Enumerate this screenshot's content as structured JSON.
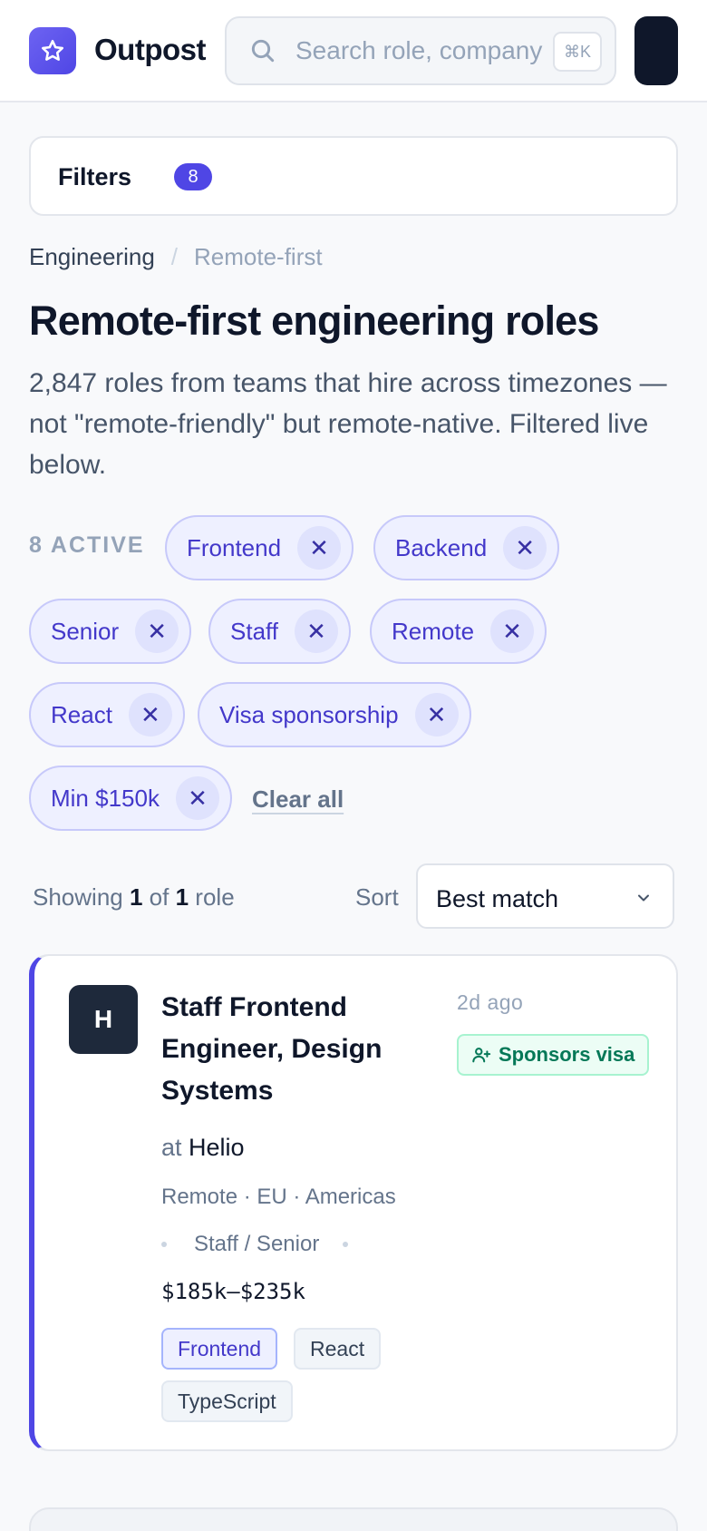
{
  "header": {
    "brand": "Outpost",
    "search_placeholder": "Search role, company",
    "shortcut": "⌘K"
  },
  "filters": {
    "label": "Filters",
    "count": "8"
  },
  "breadcrumb": {
    "parent": "Engineering",
    "separator": "/",
    "current": "Remote-first"
  },
  "page": {
    "title": "Remote-first engineering roles",
    "description": "2,847 roles from teams that hire across timezones — not \"remote-friendly\" but remote-native. Filtered live below."
  },
  "active_filters": {
    "label": "8 ACTIVE",
    "chips": [
      "Frontend",
      "Backend",
      "Senior",
      "Staff",
      "Remote",
      "React",
      "Visa sponsorship",
      "Min $150k"
    ],
    "remove_glyph": "✕",
    "clear_all": "Clear all"
  },
  "results": {
    "showing_prefix": "Showing",
    "shown": "1",
    "of": "of",
    "total": "1",
    "unit": "role",
    "sort_label": "Sort",
    "sort_value": "Best match"
  },
  "job": {
    "logo_letter": "H",
    "title": "Staff Frontend Engineer, Design Systems",
    "posted": "2d  ago",
    "badge": "Sponsors visa",
    "at": "at",
    "company": "Helio",
    "location": "Remote · EU · Americas",
    "level": "Staff / Senior",
    "salary": "$185k–$235k",
    "tags": [
      "Frontend",
      "React",
      "TypeScript"
    ]
  },
  "colors": {
    "accent": "#4f46e5",
    "success": "#047857"
  }
}
